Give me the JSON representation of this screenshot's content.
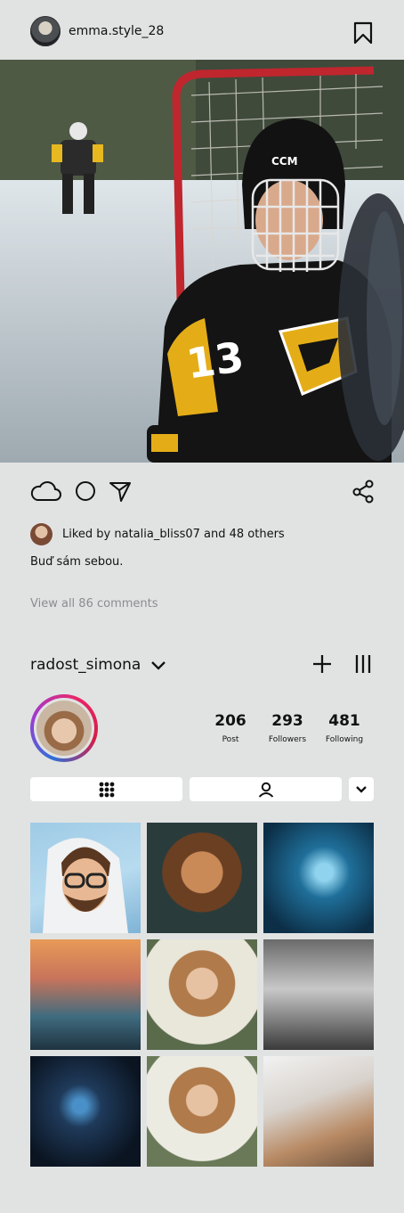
{
  "post": {
    "username": "emma.style_28",
    "likes_text": "Liked by natalia_bliss07 and 48 others",
    "caption": "Buď sám sebou.",
    "view_comments": "View all 86 comments",
    "player_number": "13",
    "helmet_brand": "CCM"
  },
  "profile": {
    "name": "radost_simona",
    "stats": [
      {
        "value": "206",
        "label": "Post"
      },
      {
        "value": "293",
        "label": "Followers"
      },
      {
        "value": "481",
        "label": "Following"
      }
    ]
  },
  "icons": {
    "bookmark": "bookmark-icon",
    "like": "cloud-icon",
    "comment": "circle-icon",
    "send": "send-icon",
    "share": "share-icon",
    "grid_tab": "grid-icon",
    "tagged_tab": "person-icon",
    "more": "chevron-down-icon",
    "add": "plus-icon",
    "menu": "menu-icon"
  },
  "colors": {
    "background": "#e1e3e3",
    "tab_background": "#ffffff",
    "muted_text": "#8a8d8f",
    "story_ring_start": "#2f6fd6",
    "story_ring_end": "#d81b45"
  }
}
